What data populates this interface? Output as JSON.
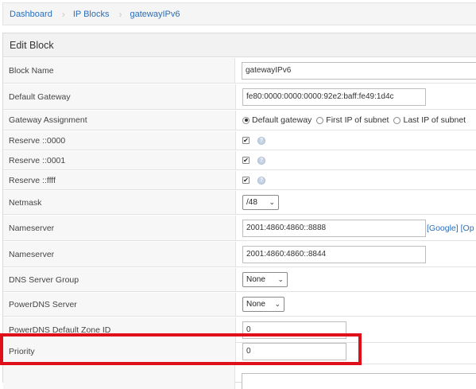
{
  "breadcrumb": [
    "Dashboard",
    "IP Blocks",
    "gatewayIPv6"
  ],
  "panel": {
    "title": "Edit Block"
  },
  "fields": {
    "block_name": {
      "label": "Block Name",
      "value": "gatewayIPv6"
    },
    "default_gateway": {
      "label": "Default Gateway",
      "value": "fe80:0000:0000:0000:92e2:baff:fe49:1d4c"
    },
    "gateway_assignment": {
      "label": "Gateway Assignment",
      "options": [
        "Default gateway",
        "First IP of subnet",
        "Last IP of subnet"
      ],
      "selected": "Default gateway"
    },
    "reserve_0000": {
      "label": "Reserve ::0000",
      "checked": true
    },
    "reserve_0001": {
      "label": "Reserve ::0001",
      "checked": true
    },
    "reserve_ffff": {
      "label": "Reserve ::ffff",
      "checked": true
    },
    "netmask": {
      "label": "Netmask",
      "value": "/48"
    },
    "nameserver1": {
      "label": "Nameserver",
      "value": "2001:4860:4860::8888",
      "links": "[Google] [Op"
    },
    "nameserver2": {
      "label": "Nameserver",
      "value": "2001:4860:4860::8844"
    },
    "dns_server_group": {
      "label": "DNS Server Group",
      "value": "None"
    },
    "powerdns_server": {
      "label": "PowerDNS Server",
      "value": "None"
    },
    "powerdns_default_zone_id": {
      "label": "PowerDNS Default Zone ID",
      "value": "0"
    },
    "priority": {
      "label": "Priority",
      "value": "0"
    }
  },
  "icons": {
    "chevron": "chevron-down-icon",
    "check": "check-icon",
    "help": "help-icon"
  },
  "colors": {
    "link": "#2a6ebb",
    "highlight": "#e0101a"
  }
}
